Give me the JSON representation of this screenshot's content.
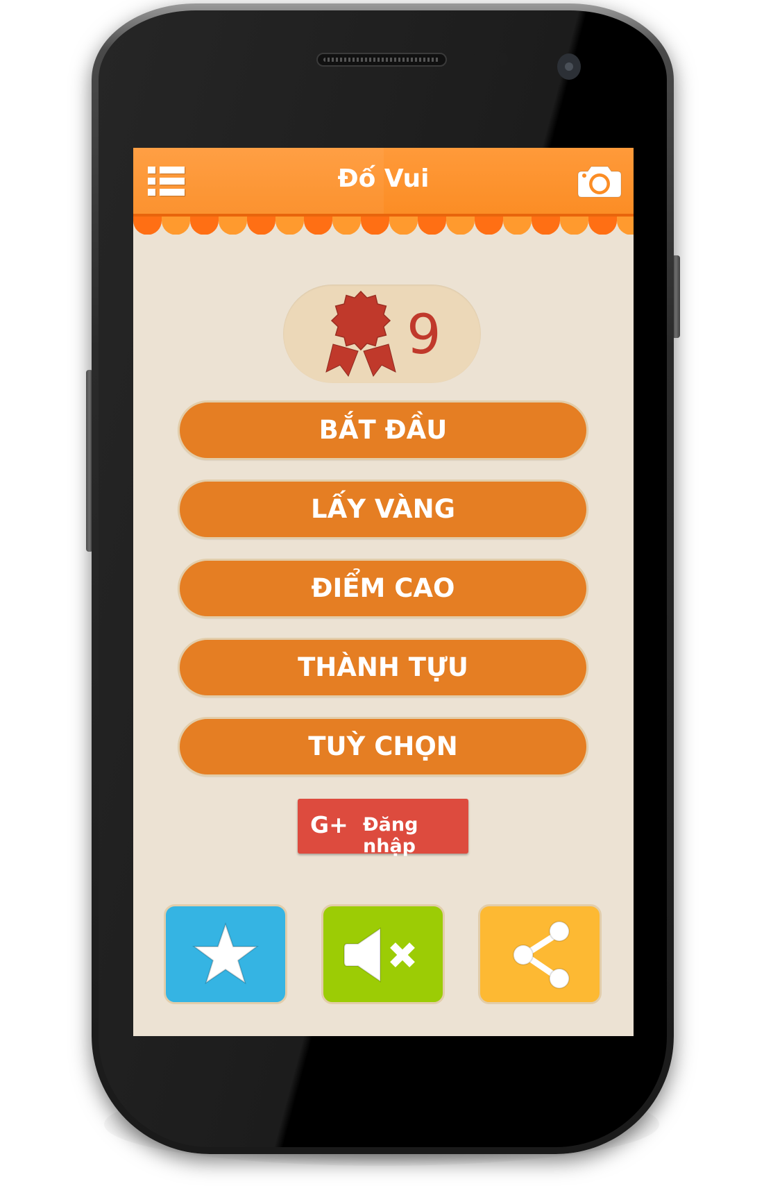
{
  "app": {
    "title": "Đố Vui",
    "header_color": "#FB8D25"
  },
  "header": {
    "menu_icon": "list-menu-icon",
    "camera_icon": "camera-icon"
  },
  "badge": {
    "icon": "award-ribbon-icon",
    "count": "9",
    "icon_color": "#C0392B"
  },
  "menu": {
    "items": [
      {
        "label": "BẮT ĐẦU"
      },
      {
        "label": "LẤY VÀNG"
      },
      {
        "label": "ĐIỂM CAO"
      },
      {
        "label": "THÀNH TỰU"
      },
      {
        "label": "TUỲ CHỌN"
      }
    ],
    "button_color": "#E57E23"
  },
  "google_signin": {
    "icon_text": "G+",
    "label": "Đăng nhập",
    "color": "#DD4B3E"
  },
  "bottom_buttons": [
    {
      "name": "rate",
      "icon": "star-icon",
      "color": "#35B4E3"
    },
    {
      "name": "sound",
      "icon": "sound-muted-icon",
      "color": "#9CCC05"
    },
    {
      "name": "share",
      "icon": "share-icon",
      "color": "#FDB933"
    }
  ]
}
